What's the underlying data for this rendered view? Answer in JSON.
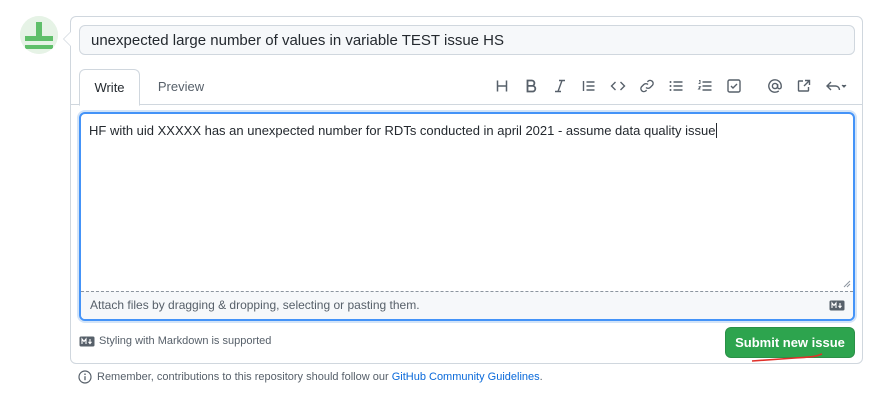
{
  "issue_form": {
    "title_value": "unexpected large number of values in variable TEST issue HS",
    "tabs": [
      {
        "label": "Write"
      },
      {
        "label": "Preview"
      }
    ],
    "toolbar_icons": [
      "heading-icon",
      "bold-icon",
      "italic-icon",
      "quote-icon",
      "code-icon",
      "link-icon",
      "bulleted-list-icon",
      "numbered-list-icon",
      "task-list-icon",
      "mention-icon",
      "cross-reference-icon",
      "reply-icon"
    ],
    "body_value": "HF with uid XXXXX has an unexpected number for RDTs conducted in april 2021 - assume data quality issue",
    "attach_hint": "Attach files by dragging & dropping, selecting or pasting them.",
    "markdown_note": "Styling with Markdown is supported",
    "submit_label": "Submit new issue"
  },
  "footer": {
    "text_before_link": "Remember, contributions to this repository should follow our ",
    "link_text": "GitHub Community Guidelines",
    "text_after_link": "."
  },
  "colors": {
    "accent_focus": "#4493f8",
    "submit_green": "#2da44e",
    "link_blue": "#0969da",
    "annotation_red": "#e0302a"
  }
}
